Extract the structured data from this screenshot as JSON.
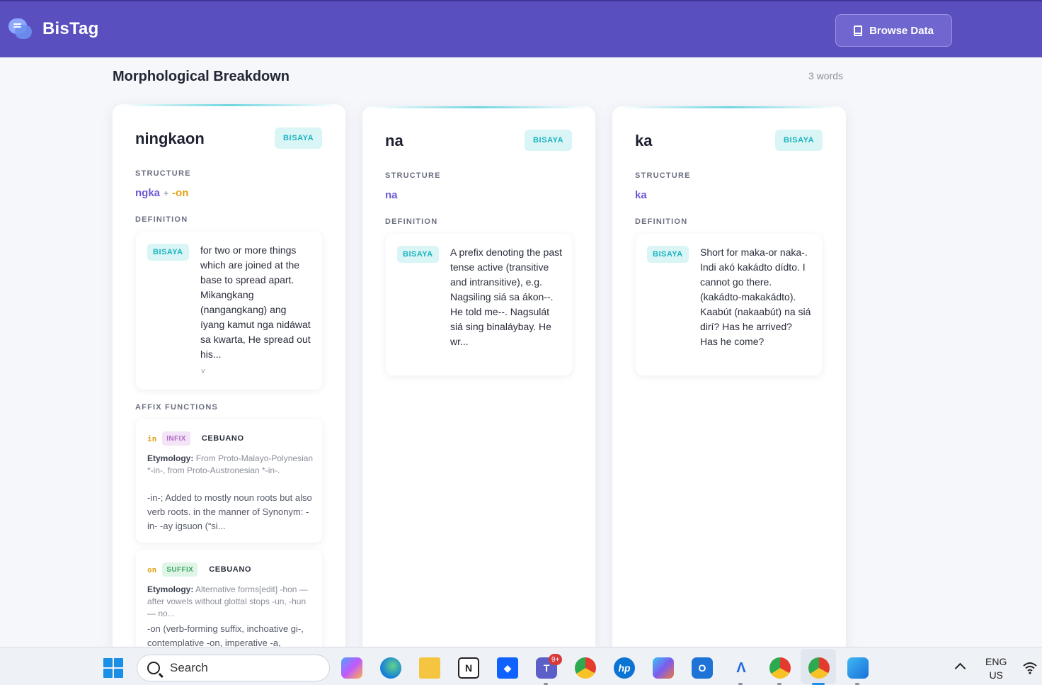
{
  "app": {
    "name": "BisTag",
    "browse_label": "Browse Data"
  },
  "section": {
    "title": "Morphological Breakdown",
    "count": "3 words"
  },
  "labels": {
    "structure": "STRUCTURE",
    "definition": "DEFINITION",
    "affix_functions": "AFFIX FUNCTIONS"
  },
  "cards": [
    {
      "word": "ningkaon",
      "lang": "BISAYA",
      "structure": {
        "root": "ngka",
        "plus": "+",
        "affix": "-on"
      },
      "definition": {
        "lang": "BISAYA",
        "text": "for two or more things which are joined at the base to spread apart. Mikangkang (nangangkang) ang íyang kamut nga nidáwat sa kwarta, He spread out his...",
        "pos": "v"
      },
      "affixes": [
        {
          "code": "in",
          "type": "INFIX",
          "lang": "CEBUANO",
          "ety_label": "Etymology:",
          "ety": "From Proto-Malayo-Polynesian *-in-, from Proto-Austronesian *-in-.",
          "desc": "-in-; Added to mostly noun roots but also verb roots. in the manner of Synonym: -in- -ay igsuon (“si..."
        },
        {
          "code": "on",
          "type": "SUFFIX",
          "lang": "CEBUANO",
          "ety_label": "Etymology:",
          "ety": "Alternative forms[edit] -hon — after vowels without glottal stops -un, -hun — no...",
          "desc": "-on (verb-forming suffix, inchoative gi-, contemplative -on, imperative -a,"
        }
      ]
    },
    {
      "word": "na",
      "lang": "BISAYA",
      "structure": {
        "root": "na"
      },
      "definition": {
        "lang": "BISAYA",
        "text": "A prefix denoting the past tense active (transitive and intransitive), e.g. Nagsiling siá sa ákon--. He told me--. Nagsulát siá sing binaláybay. He wr..."
      }
    },
    {
      "word": "ka",
      "lang": "BISAYA",
      "structure": {
        "root": "ka"
      },
      "definition": {
        "lang": "BISAYA",
        "text": "Short for maka-or naka-. Indi akó kakádto dídto. I cannot go there. (kakádto-makakádto). Kaabút (nakaabút) na siá dirí? Has he arrived? Has he come?"
      }
    }
  ],
  "taskbar": {
    "search_placeholder": "Search",
    "notification_count": "9+",
    "lang_line1": "ENG",
    "lang_line2": "US",
    "apps": [
      "copilot-icon",
      "edge-icon",
      "file-explorer-icon",
      "notion-icon",
      "dropbox-icon",
      "teams-icon",
      "chrome-icon",
      "hp-icon",
      "m365-icon",
      "outlook-icon",
      "arc-icon",
      "chrome-profile-icon",
      "chrome-active-icon",
      "photos-icon"
    ]
  }
}
